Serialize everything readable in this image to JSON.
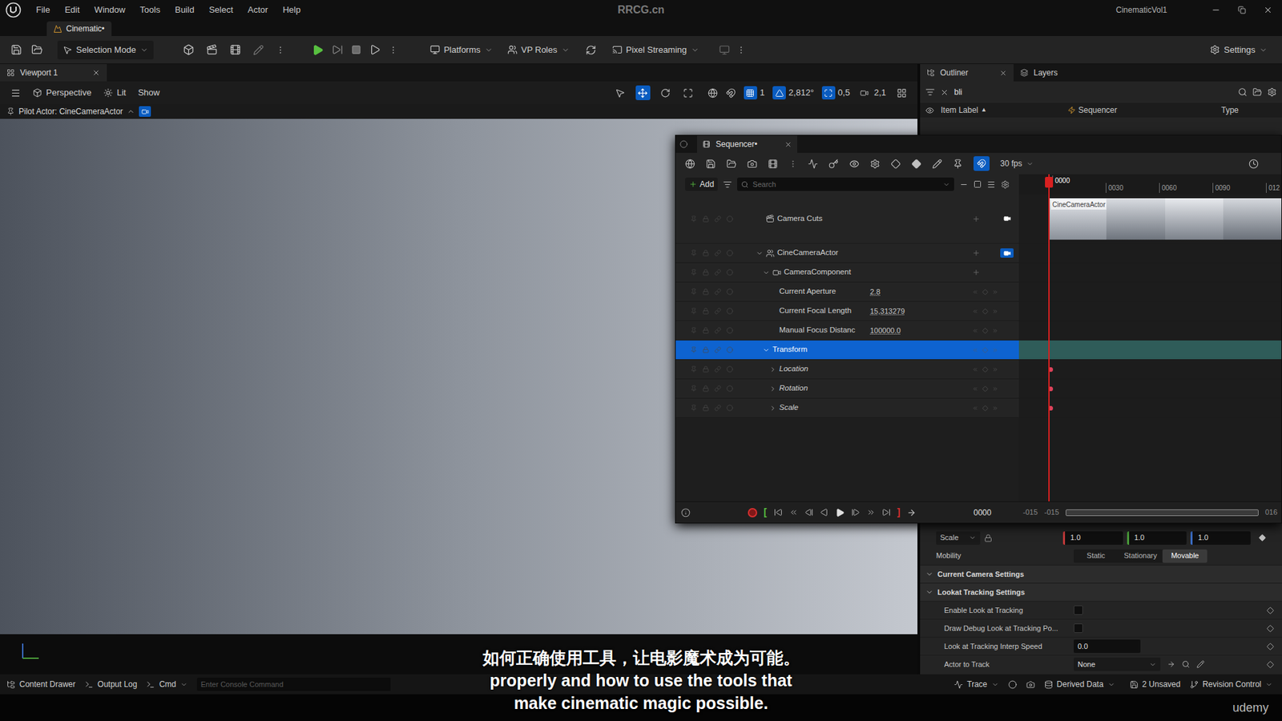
{
  "app": {
    "title": "RRCG.cn",
    "project": "CinematicVol1"
  },
  "menu": [
    "File",
    "Edit",
    "Window",
    "Tools",
    "Build",
    "Select",
    "Actor",
    "Help"
  ],
  "level_tab": "Cinematic•",
  "toolbar": {
    "selection_mode": "Selection Mode",
    "platforms": "Platforms",
    "vp_roles": "VP Roles",
    "pixel_streaming": "Pixel Streaming",
    "settings": "Settings"
  },
  "viewport": {
    "tab": "Viewport 1",
    "perspective": "Perspective",
    "lit": "Lit",
    "show": "Show",
    "pilot": "Pilot Actor: CineCameraActor",
    "tools": [
      {
        "kind": "select",
        "selected": false
      },
      {
        "kind": "move",
        "selected": true
      },
      {
        "kind": "rotate",
        "selected": false
      },
      {
        "kind": "scale",
        "selected": false
      }
    ],
    "snaps": [
      {
        "kind": "grid",
        "label": "1",
        "active": true
      },
      {
        "kind": "angle",
        "label": "2,812°",
        "active": true
      },
      {
        "kind": "scale",
        "label": "0,5",
        "active": true
      },
      {
        "kind": "camera",
        "label": "2,1",
        "active": false
      }
    ]
  },
  "outliner": {
    "tabs": [
      {
        "label": "Outliner",
        "selected": true
      },
      {
        "label": "Layers",
        "selected": false
      }
    ],
    "search": "bli",
    "columns": [
      "Item Label",
      "Sequencer",
      "Type"
    ],
    "sort_column": "Item Label",
    "sort_mark": "▲"
  },
  "sequencer": {
    "tab": "Sequencer•",
    "fps": "30 fps",
    "add": "Add",
    "search_placeholder": "Search",
    "ruler": [
      "0000",
      "0030",
      "0060",
      "0090",
      "012"
    ],
    "tracks": [
      {
        "label": "Camera Cuts",
        "kind": "cuts",
        "depth": 0,
        "selected": false,
        "keyed": false,
        "thumb_label": "CineCameraActor"
      },
      {
        "label": "CineCameraActor",
        "kind": "actor",
        "depth": 0,
        "expanded": true,
        "selected": false,
        "keyed": false
      },
      {
        "label": "CameraComponent",
        "kind": "component",
        "depth": 1,
        "expanded": true,
        "selected": false,
        "keyed": false
      },
      {
        "label": "Current Aperture",
        "kind": "property",
        "depth": 2,
        "value": "2.8",
        "selected": false,
        "keyed": false
      },
      {
        "label": "Current Focal Length",
        "kind": "property",
        "depth": 2,
        "value": "15,313279",
        "selected": false,
        "keyed": false
      },
      {
        "label": "Manual Focus Distanc",
        "kind": "property",
        "depth": 2,
        "value": "100000.0",
        "selected": false,
        "keyed": false
      },
      {
        "label": "Transform",
        "kind": "transform",
        "depth": 1,
        "expanded": true,
        "selected": true,
        "keyed": false
      },
      {
        "label": "Location",
        "kind": "channel",
        "depth": 2,
        "expanded": false,
        "selected": false,
        "keyed": true
      },
      {
        "label": "Rotation",
        "kind": "channel",
        "depth": 2,
        "expanded": false,
        "selected": false,
        "keyed": true
      },
      {
        "label": "Scale",
        "kind": "channel",
        "depth": 2,
        "expanded": false,
        "selected": false,
        "keyed": true
      }
    ],
    "transport": {
      "start_mark": "[",
      "end_mark": "]",
      "frame": "0000",
      "view_start": "-015",
      "work_start": "-015",
      "view_end": "016"
    }
  },
  "details": {
    "scale_label": "Scale",
    "scale": [
      {
        "value": "1.0",
        "color": "#c33a3a"
      },
      {
        "value": "1.0",
        "color": "#4a9c3a"
      },
      {
        "value": "1.0",
        "color": "#3a6cc3"
      }
    ],
    "mobility_label": "Mobility",
    "mobility": [
      {
        "label": "Static",
        "selected": false
      },
      {
        "label": "Stationary",
        "selected": false
      },
      {
        "label": "Movable",
        "selected": true
      }
    ],
    "sections": [
      {
        "label": "Current Camera Settings",
        "expanded": true
      },
      {
        "label": "Lookat Tracking Settings",
        "expanded": true
      }
    ],
    "rows": [
      {
        "label": "Enable Look at Tracking",
        "kind": "checkbox",
        "checked": false
      },
      {
        "label": "Draw Debug Look at Tracking Po...",
        "kind": "checkbox",
        "checked": false
      },
      {
        "label": "Look at Tracking Interp Speed",
        "kind": "number",
        "value": "0.0"
      },
      {
        "label": "Actor to Track",
        "kind": "dropdown",
        "value": "None"
      }
    ]
  },
  "status_bar": {
    "content_drawer": "Content Drawer",
    "output_log": "Output Log",
    "cmd": "Cmd",
    "console_placeholder": "Enter Console Command",
    "trace": "Trace",
    "derived_data": "Derived Data",
    "unsaved": "2 Unsaved",
    "revision_control": "Revision Control"
  },
  "subtitles": [
    "如何正确使用工具，让电影魔术成为可能。",
    "properly and how to use the tools that",
    "make cinematic magic possible."
  ],
  "watermark": "udemy"
}
